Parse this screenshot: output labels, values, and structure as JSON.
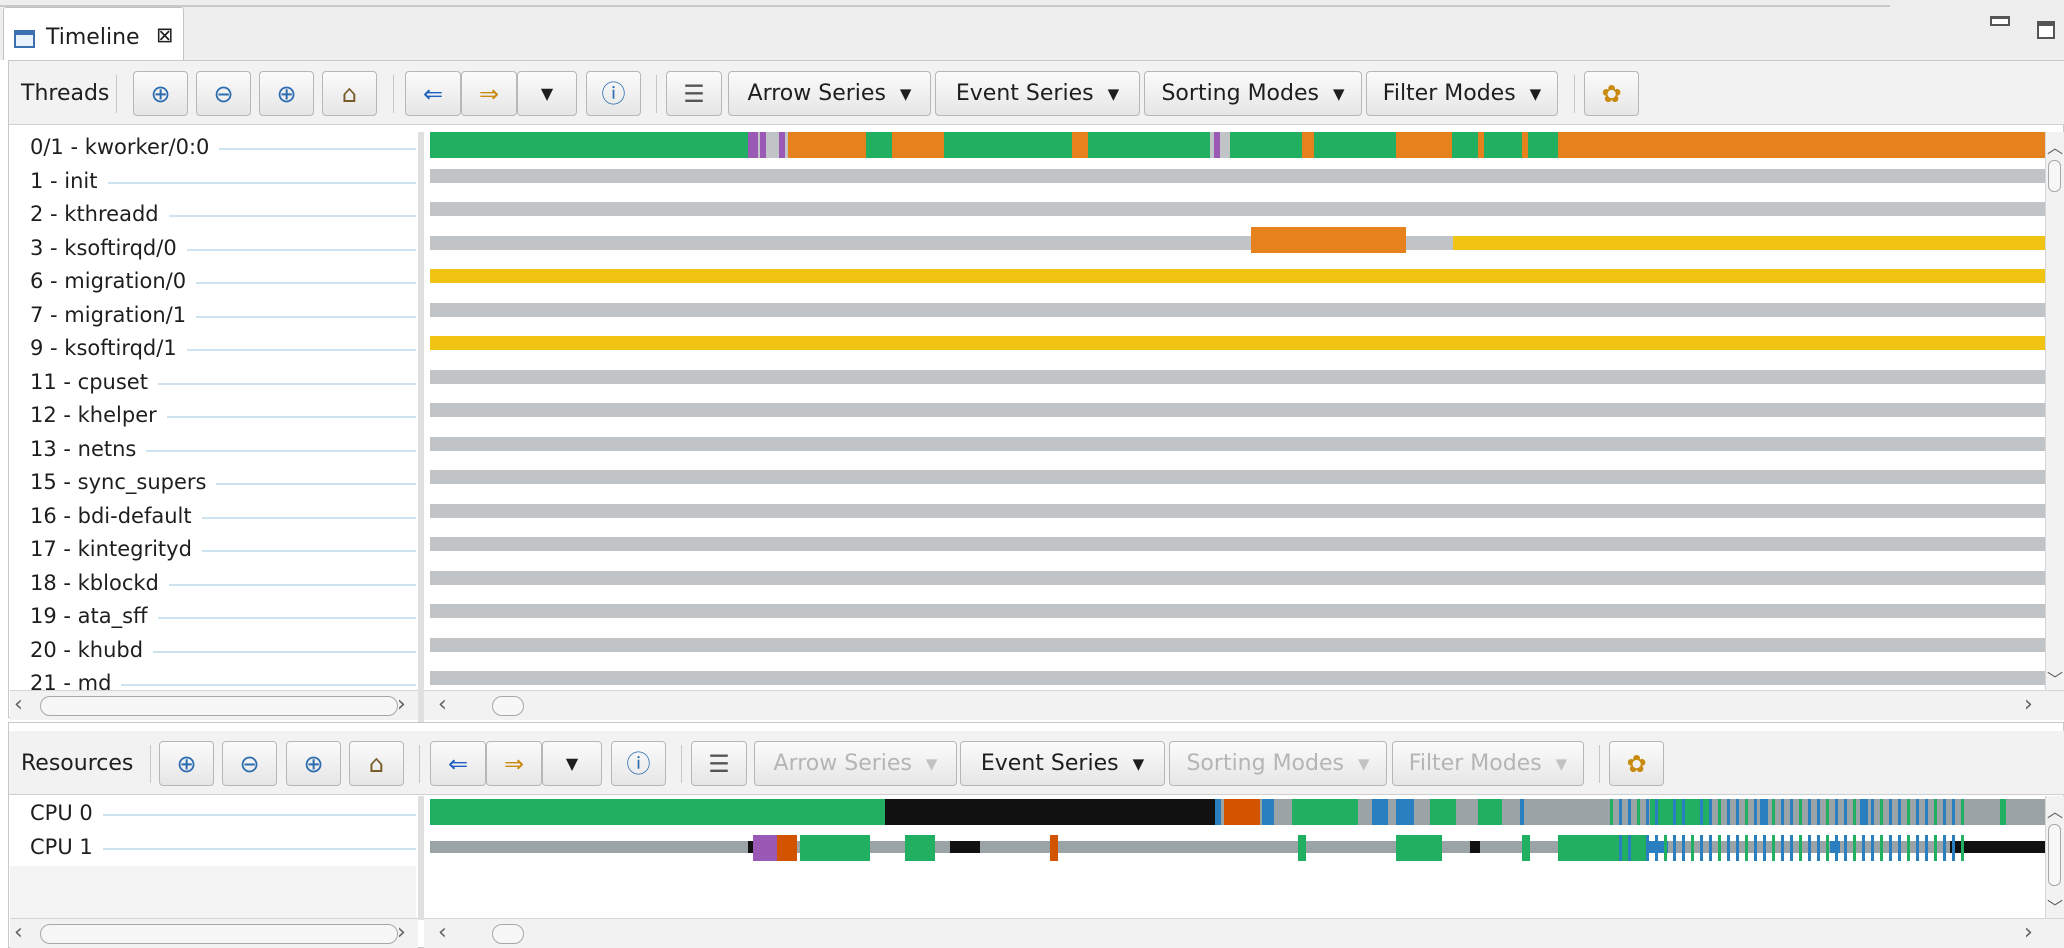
{
  "view": {
    "title": "Timeline",
    "close_glyph": "⊠"
  },
  "window_buttons": {
    "minimize_icon": "minimize-icon",
    "maximize_icon": "maximize-icon"
  },
  "threads_toolbar": {
    "title": "Threads",
    "arrow_series": "Arrow Series",
    "event_series": "Event Series",
    "sorting_modes": "Sorting Modes",
    "filter_modes": "Filter Modes",
    "arrow_series_enabled": true,
    "sorting_modes_enabled": true,
    "filter_modes_enabled": true
  },
  "resources_toolbar": {
    "title": "Resources",
    "arrow_series": "Arrow Series",
    "event_series": "Event Series",
    "sorting_modes": "Sorting Modes",
    "filter_modes": "Filter Modes",
    "arrow_series_enabled": false,
    "sorting_modes_enabled": false,
    "filter_modes_enabled": false
  },
  "toolbar_icons": [
    "zoom-in-icon",
    "zoom-out-icon",
    "zoom-selection-icon",
    "home-icon",
    "previous-event-icon",
    "next-event-icon",
    "dropdown-icon",
    "help-icon",
    "legend-icon",
    "settings-icon"
  ],
  "colors": {
    "idle": "#c0c4c7",
    "running": "#21b062",
    "waiting": "#e6821e",
    "blocked": "#f1c313",
    "interrupt": "#9b59b6",
    "cpu_idle": "#9aa3a5",
    "syscall": "#2a7fc0",
    "irq": "#d35400",
    "selection_line": "#cde3f0"
  },
  "threads": [
    {
      "name": "0/1 - kworker/0:0",
      "state": "active"
    },
    {
      "name": "1 - init",
      "state": "idle"
    },
    {
      "name": "2 - kthreadd",
      "state": "idle"
    },
    {
      "name": "3 - ksoftirqd/0",
      "state": "mixed"
    },
    {
      "name": "6 - migration/0",
      "state": "blocked"
    },
    {
      "name": "7 - migration/1",
      "state": "idle"
    },
    {
      "name": "9 - ksoftirqd/1",
      "state": "blocked"
    },
    {
      "name": "11 - cpuset",
      "state": "idle"
    },
    {
      "name": "12 - khelper",
      "state": "idle"
    },
    {
      "name": "13 - netns",
      "state": "idle"
    },
    {
      "name": "15 - sync_supers",
      "state": "idle"
    },
    {
      "name": "16 - bdi-default",
      "state": "idle"
    },
    {
      "name": "17 - kintegrityd",
      "state": "idle"
    },
    {
      "name": "18 - kblockd",
      "state": "idle"
    },
    {
      "name": "19 - ata_sff",
      "state": "idle"
    },
    {
      "name": "20 - khubd",
      "state": "idle"
    },
    {
      "name": "21 - md",
      "state": "idle"
    }
  ],
  "resources": [
    {
      "name": "CPU 0"
    },
    {
      "name": "CPU 1"
    }
  ]
}
